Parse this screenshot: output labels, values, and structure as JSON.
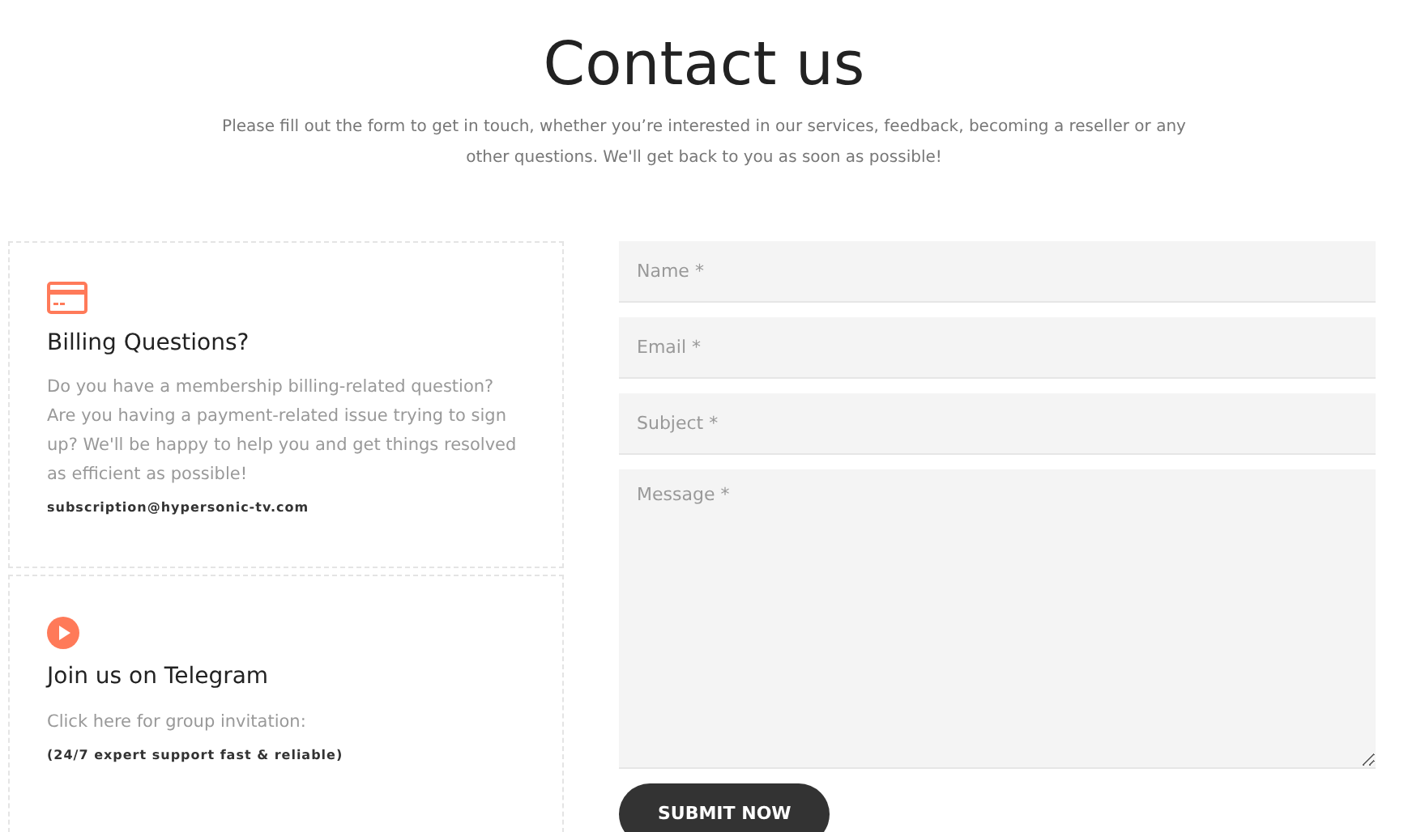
{
  "header": {
    "title": "Contact us",
    "intro": "Please fill out the form to get in touch, whether you’re interested in our services, feedback, becoming a reseller or any other questions. We'll get back to you as soon as possible!"
  },
  "info_cards": [
    {
      "kind": "card",
      "title": "Billing Questions?",
      "text": "Do you have a membership billing-related question? Are you having a payment-related issue trying to sign up? We'll be happy to help you and get things resolved as efficient as possible!",
      "detail": "subscription@hypersonic-tv.com"
    },
    {
      "kind": "play",
      "title": "Join us on Telegram",
      "text": "Click here for group invitation:",
      "detail": "(24/7 expert support fast & reliable)"
    }
  ],
  "form": {
    "fields": [
      {
        "kind": "input",
        "placeholder": "Name *"
      },
      {
        "kind": "input",
        "placeholder": "Email *"
      },
      {
        "kind": "input",
        "placeholder": "Subject *"
      },
      {
        "kind": "textarea",
        "placeholder": "Message *"
      }
    ],
    "submit": "SUBMIT NOW"
  }
}
